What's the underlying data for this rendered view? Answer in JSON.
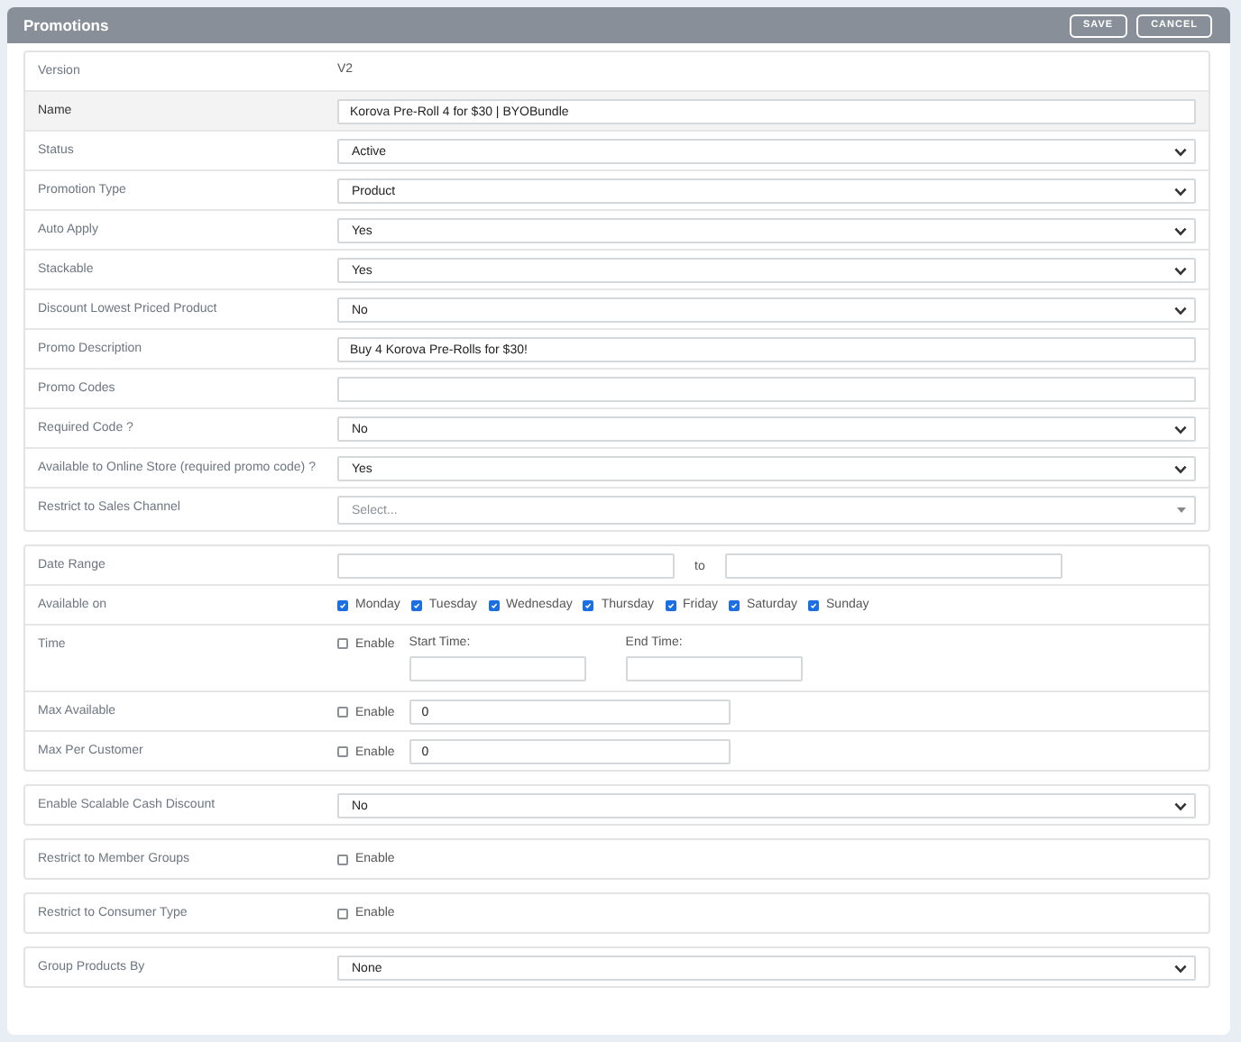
{
  "panel": {
    "title": "Promotions",
    "buttons": [
      "SAVE",
      "CANCEL"
    ]
  },
  "sections": [
    {
      "rows": [
        {
          "label": "Version",
          "kind": "text",
          "value": "V2",
          "highlighted": false
        },
        {
          "label": "Name",
          "kind": "input",
          "value": "Korova Pre-Roll 4 for $30 | BYOBundle",
          "highlighted": true
        },
        {
          "label": "Status",
          "kind": "select",
          "value": "Active",
          "highlighted": false
        },
        {
          "label": "Promotion Type",
          "kind": "select",
          "value": "Product",
          "highlighted": false
        },
        {
          "label": "Auto Apply",
          "kind": "select",
          "value": "Yes",
          "highlighted": false
        },
        {
          "label": "Stackable",
          "kind": "select",
          "value": "Yes",
          "highlighted": false
        },
        {
          "label": "Discount Lowest Priced Product",
          "kind": "select",
          "value": "No",
          "highlighted": false
        },
        {
          "label": "Promo Description",
          "kind": "input",
          "value": "Buy 4 Korova Pre-Rolls for $30!",
          "highlighted": false
        },
        {
          "label": "Promo Codes",
          "kind": "input",
          "highlighted": false
        },
        {
          "label": "Required Code ?",
          "kind": "select",
          "value": "No",
          "highlighted": false
        },
        {
          "label": "Available to Online Store (required promo code) ?",
          "kind": "select",
          "value": "Yes",
          "highlighted": false
        },
        {
          "label": "Restrict to Sales Channel",
          "kind": "multiselect",
          "placeholder": "Select...",
          "highlighted": false
        }
      ]
    },
    {
      "rows": [
        {
          "label": "Date Range",
          "kind": "daterange",
          "separator": "to",
          "highlighted": false
        },
        {
          "label": "Available on",
          "kind": "days",
          "highlighted": false,
          "options": [
            {
              "label": "Monday",
              "checked": true
            },
            {
              "label": "Tuesday",
              "checked": true
            },
            {
              "label": "Wednesday",
              "checked": true
            },
            {
              "label": "Thursday",
              "checked": true
            },
            {
              "label": "Friday",
              "checked": true
            },
            {
              "label": "Saturday",
              "checked": true
            },
            {
              "label": "Sunday",
              "checked": true
            }
          ]
        },
        {
          "label": "Time",
          "kind": "time",
          "highlighted": false,
          "enable": {
            "label": "Enable",
            "checked": false
          },
          "fields": [
            "Start Time:",
            "End Time:"
          ]
        },
        {
          "label": "Max Available",
          "kind": "limit",
          "highlighted": false,
          "enable": {
            "label": "Enable",
            "checked": false
          },
          "value": "0"
        },
        {
          "label": "Max Per Customer",
          "kind": "limit",
          "highlighted": false,
          "enable": {
            "label": "Enable",
            "checked": false
          },
          "value": "0"
        }
      ]
    },
    {
      "rows": [
        {
          "label": "Enable Scalable Cash Discount",
          "kind": "select",
          "value": "No",
          "highlighted": false
        }
      ]
    },
    {
      "rows": [
        {
          "label": "Restrict to Member Groups",
          "kind": "toggle",
          "highlighted": false,
          "enable": {
            "label": "Enable",
            "checked": false
          }
        }
      ]
    },
    {
      "rows": [
        {
          "label": "Restrict to Consumer Type",
          "kind": "toggle",
          "highlighted": false,
          "enable": {
            "label": "Enable",
            "checked": false
          }
        }
      ]
    },
    {
      "rows": [
        {
          "label": "Group Products By",
          "kind": "select",
          "value": "None",
          "highlighted": false
        }
      ]
    }
  ]
}
